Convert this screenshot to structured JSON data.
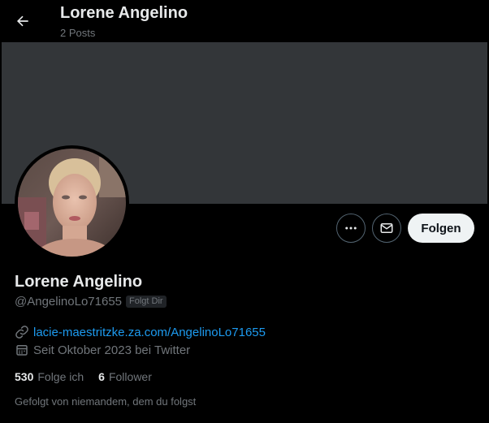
{
  "header": {
    "title": "Lorene Angelino",
    "posts_count": "2 Posts"
  },
  "profile": {
    "display_name": "Lorene Angelino",
    "handle": "@AngelinoLo71655",
    "follows_you_badge": "Folgt Dir",
    "website": "lacie-maestritzke.za.com/AngelinoLo71655",
    "joined": "Seit Oktober 2023 bei Twitter"
  },
  "actions": {
    "follow_label": "Folgen",
    "more_icon": "more-horizontal-icon",
    "message_icon": "mail-icon"
  },
  "stats": {
    "following_count": "530",
    "following_label": "Folge ich",
    "followers_count": "6",
    "followers_label": "Follower"
  },
  "followed_by_text": "Gefolgt von niemandem, dem du folgst",
  "colors": {
    "background": "#000000",
    "banner": "#333639",
    "link": "#1d9bf0",
    "secondary_text": "#71767b",
    "primary_text": "#e7e9ea",
    "follow_button_bg": "#eff3f4"
  }
}
